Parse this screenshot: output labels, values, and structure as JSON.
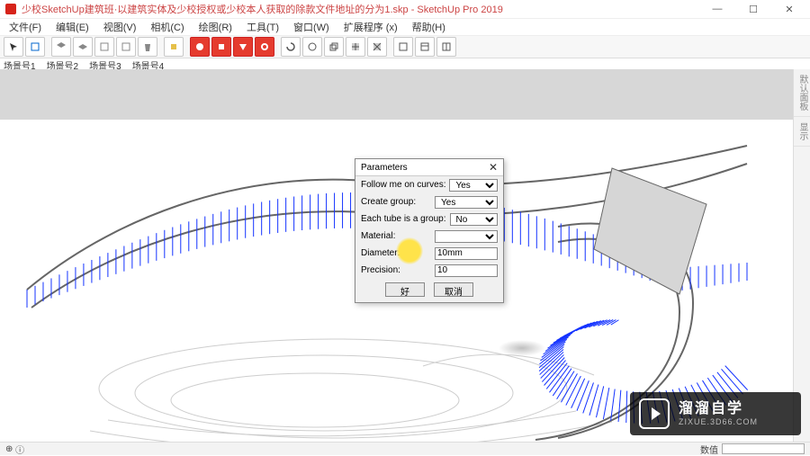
{
  "title": "少校SketchUp建筑班·以建筑实体及少校授权或少校本人获取的除款文件地址的分为1.skp - SketchUp Pro 2019",
  "menus": [
    "文件(F)",
    "编辑(E)",
    "视图(V)",
    "相机(C)",
    "绘图(R)",
    "工具(T)",
    "窗口(W)",
    "扩展程序 (x)",
    "帮助(H)"
  ],
  "scenes": [
    "场景号1",
    "场景号2",
    "场景号3",
    "场景号4"
  ],
  "window_controls": {
    "min": "—",
    "max": "☐",
    "close": "✕"
  },
  "sidetabs": [
    "默认面板",
    "显示"
  ],
  "status": {
    "left_icons": [
      "⊕",
      "ⓘ"
    ],
    "measure_label": "数值"
  },
  "dialog": {
    "title": "Parameters",
    "rows": [
      {
        "label": "Follow me on curves:",
        "type": "select",
        "value": "Yes"
      },
      {
        "label": "Create group:",
        "type": "select",
        "value": "Yes"
      },
      {
        "label": "Each tube is a group:",
        "type": "select",
        "value": "No"
      },
      {
        "label": "Material:",
        "type": "select",
        "value": ""
      },
      {
        "label": "Diameter:",
        "type": "input",
        "value": "10mm"
      },
      {
        "label": "Precision:",
        "type": "input",
        "value": "10"
      }
    ],
    "ok": "好",
    "cancel": "取消"
  },
  "watermark": {
    "big": "溜溜自学",
    "small": "ZIXUE.3D66.COM"
  }
}
